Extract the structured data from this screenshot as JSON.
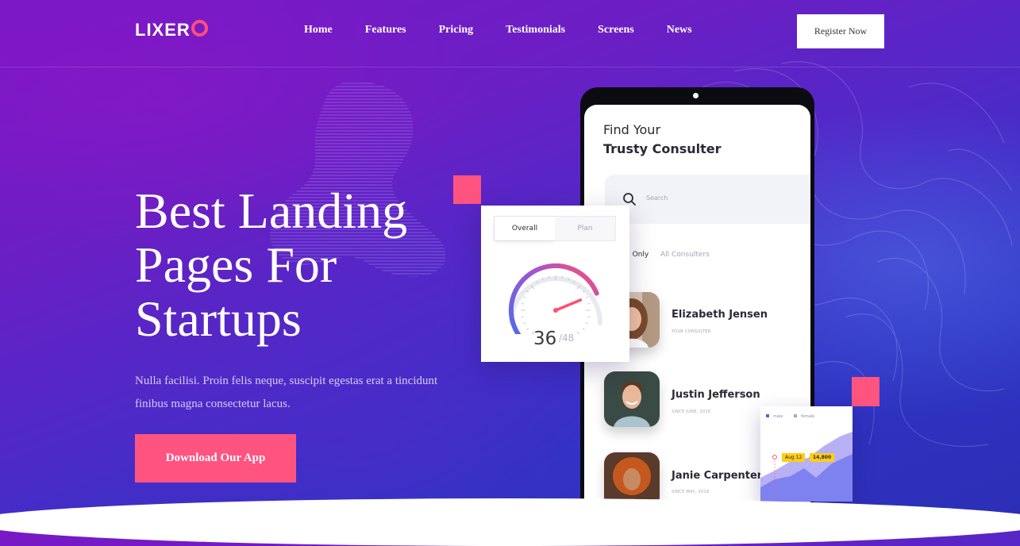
{
  "brand": {
    "name_prefix": "LIXER",
    "name_suffix_icon": "ring-o"
  },
  "nav": {
    "items": [
      "Home",
      "Features",
      "Pricing",
      "Testimonials",
      "Screens",
      "News"
    ],
    "cta_label": "Register Now"
  },
  "hero": {
    "title": "Best Landing Pages For Startups",
    "subtitle": "Nulla facilisi. Proin felis neque, suscipit egestas erat a tincidunt finibus magna consectetur lacus.",
    "button_label": "Download Our App"
  },
  "phone": {
    "heading_line1": "Find Your",
    "heading_line2": "Trusty Consulter",
    "search_placeholder": "Search",
    "filter_active": "d Only",
    "filter_inactive": "All Consulters",
    "consultants": [
      {
        "name": "Elizabeth Jensen",
        "meta": "YOUR CONSULTER"
      },
      {
        "name": "Justin Jefferson",
        "meta": "SINCE JUNE, 2016"
      },
      {
        "name": "Janie Carpenter",
        "meta": "SINCE MAY, 2018"
      }
    ]
  },
  "gauge": {
    "tabs": [
      "Overall",
      "Plan"
    ],
    "value": "36",
    "max": "/48",
    "value_num": 36,
    "max_num": 48
  },
  "area_chart": {
    "legend": [
      "male",
      "female"
    ],
    "tooltip_date": "Aug 12",
    "tooltip_value": "14,800"
  },
  "colors": {
    "accent": "#ff5380",
    "gauge_start": "#4a6cf0",
    "gauge_end": "#ff4f6e",
    "chart_male": "#7e82f0",
    "chart_female": "#b7b0f5"
  }
}
